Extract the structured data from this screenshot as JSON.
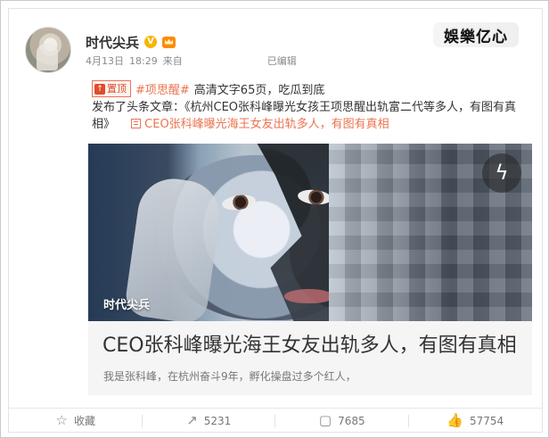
{
  "post": {
    "author": "时代尖兵",
    "verified_icon": "verified-icon",
    "vip_icon": "vip-crown-icon",
    "meta": {
      "date": "4月13日",
      "time": "18:29",
      "source_prefix": "来自",
      "edited": "已编辑"
    },
    "watermark": "娛樂亿心",
    "top_tag": "置顶",
    "hashtag": "#项思醒#",
    "headline": "高清文字65页，吃瓜到底",
    "published_text": "发布了头条文章：《杭州CEO张科峰曝光女孩王项思醒出轨富二代等多人，有图有真相》",
    "article_link": "CEO张科峰曝光海王女友出轨多人，有图有真相",
    "card": {
      "image_caption": "时代尖兵",
      "title": "CEO张科峰曝光海王女友出轨多人，有图有真相",
      "summary": "我是张科峰，在杭州奋斗9年，孵化操盘过多个红人，"
    },
    "actions": {
      "favorite": "收藏",
      "repost": "5231",
      "comment": "7685",
      "like": "57754"
    }
  },
  "colors": {
    "accent": "#eb7350",
    "text": "#333333",
    "muted": "#8a8a8a",
    "card": "#f5f5f5"
  }
}
